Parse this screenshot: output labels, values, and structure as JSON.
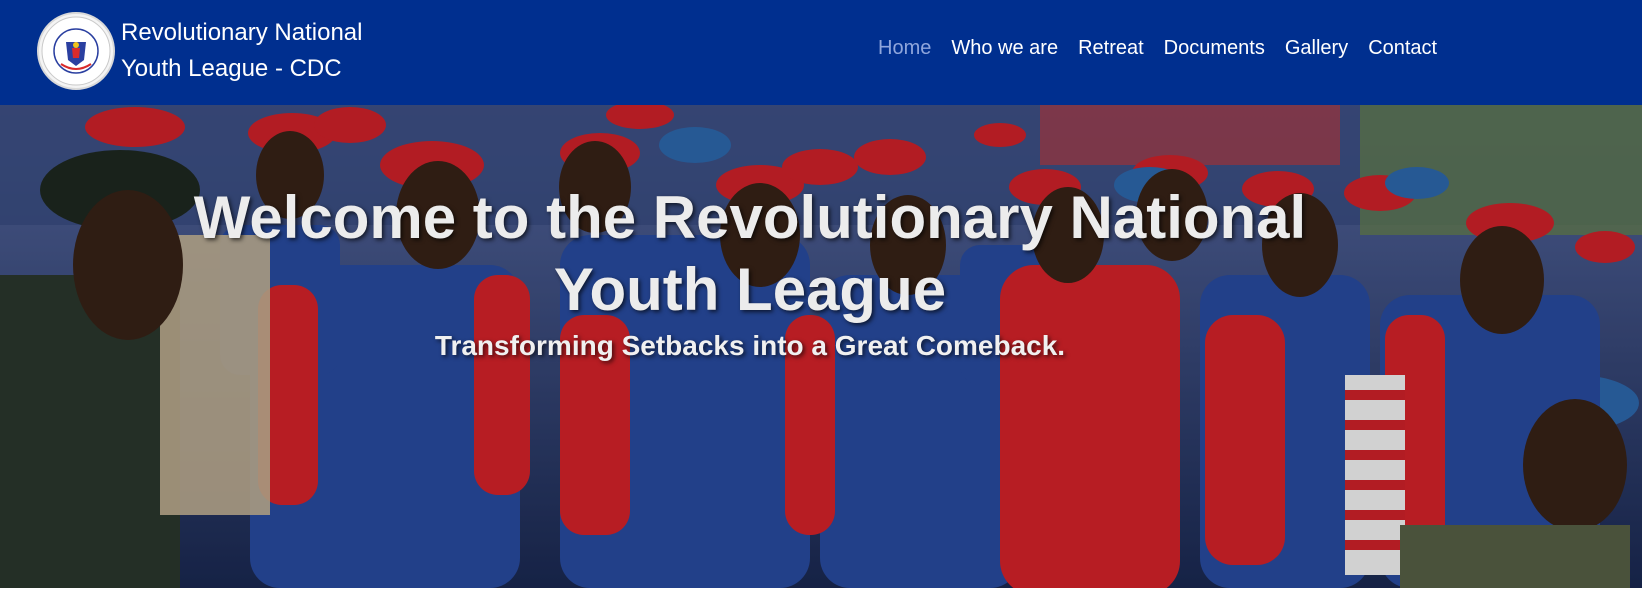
{
  "brand": {
    "line1": "Revolutionary National",
    "line2": "Youth League - CDC",
    "logo_text_top": "REVOLUTIONARY NATIONAL",
    "logo_text_bottom": "YOUTH LEAGUE"
  },
  "nav": {
    "items": [
      {
        "label": "Home",
        "active": true
      },
      {
        "label": "Who we are"
      },
      {
        "label": "Retreat"
      },
      {
        "label": "Documents"
      },
      {
        "label": "Gallery"
      },
      {
        "label": "Contact"
      }
    ]
  },
  "hero": {
    "title": "Welcome to the Revolutionary National Youth League",
    "subtitle": "Transforming Setbacks into a Great Comeback."
  },
  "colors": {
    "navbar": "#002f8f",
    "active_nav": "#8fa6dc",
    "beret_red": "#d9232b",
    "shirt_blue": "#2a4fa8"
  }
}
